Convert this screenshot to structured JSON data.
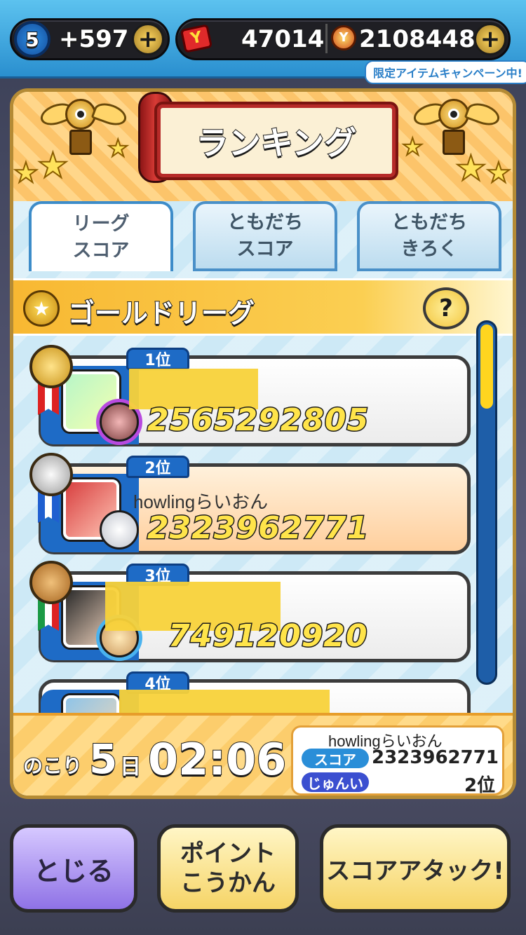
{
  "top_bar": {
    "level": "5",
    "stamina_gain": "+597",
    "gem_count": "47014",
    "money_count": "2108448",
    "add_icon": "plus",
    "campaign_badge": "限定アイテムキャンペーン中!"
  },
  "panel": {
    "title": "ランキング",
    "tabs": [
      {
        "line1": "リーグ",
        "line2": "スコア",
        "active": true
      },
      {
        "line1": "ともだち",
        "line2": "スコア",
        "active": false
      },
      {
        "line1": "ともだち",
        "line2": "きろく",
        "active": false
      }
    ],
    "league_title": "ゴールドリーグ",
    "help_label": "?"
  },
  "ranking": [
    {
      "rank": "1位",
      "name": "",
      "score": "2565292805",
      "medal": "gold",
      "highlight": false
    },
    {
      "rank": "2位",
      "name": "howlingらいおん",
      "score": "2323962771",
      "medal": "silver",
      "highlight": true
    },
    {
      "rank": "3位",
      "name": "",
      "score": "749120920",
      "medal": "bronze",
      "highlight": false
    },
    {
      "rank": "4位",
      "name": "",
      "score": "",
      "medal": "none",
      "highlight": false
    }
  ],
  "footer": {
    "remaining_label": "のこり",
    "remaining_days": "5",
    "day_unit": "日",
    "remaining_time": "02:06",
    "my_name": "howlingらいおん",
    "score_label": "スコア",
    "score_value": "2323962771",
    "rank_label": "じゅんい",
    "rank_value": "2位"
  },
  "buttons": {
    "close": "とじる",
    "exchange_line1": "ポイント",
    "exchange_line2": "こうかん",
    "score_attack": "スコアアタック!"
  },
  "colors": {
    "accent_blue": "#1e6bc6",
    "gold_band": "#f8b832",
    "highlight_row": "#ffcf9d"
  }
}
